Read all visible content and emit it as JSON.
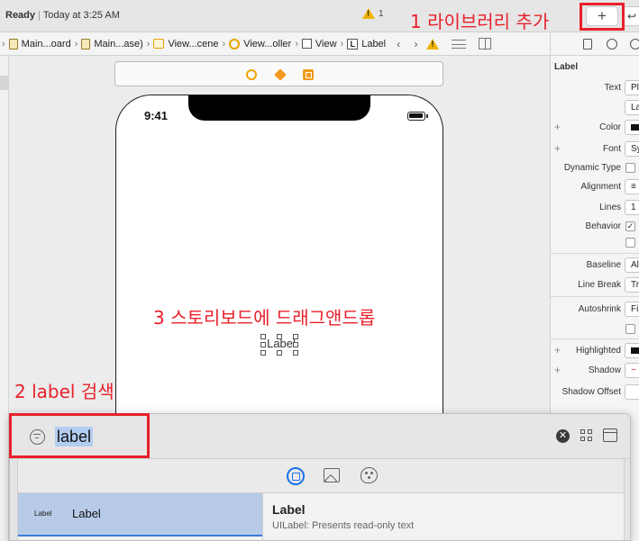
{
  "status": {
    "state": "Ready",
    "time": "Today at 3:25 AM",
    "warning_count": "1",
    "back_glyph": "↩"
  },
  "toolbar": {
    "library_glyph": "+"
  },
  "annotations": {
    "step1": "1 라이브러리 추가",
    "step2": "2 label 검색",
    "step3": "3 스토리보드에 드래그앤드롭",
    "color": "#e8212b"
  },
  "jump_bar": {
    "items": [
      {
        "label": "Main...oard",
        "icon": "storyboard-icon"
      },
      {
        "label": "Main...ase)",
        "icon": "storyboard-icon"
      },
      {
        "label": "View...cene",
        "icon": "scene-icon"
      },
      {
        "label": "View...oller",
        "icon": "view-controller-icon"
      },
      {
        "label": "View",
        "icon": "view-icon"
      },
      {
        "label": "Label",
        "icon": "label-icon"
      }
    ],
    "label_icon_glyph": "L",
    "nav_glyphs": "‹ ›"
  },
  "device": {
    "time": "9:41"
  },
  "canvas": {
    "dragged_label": "Label"
  },
  "inspector": {
    "title": "Label",
    "rows": {
      "text": {
        "label": "Text",
        "value": "Plain"
      },
      "text_value": {
        "value": "Label"
      },
      "color": {
        "label": "Color",
        "value": ""
      },
      "font": {
        "label": "Font",
        "value": "System"
      },
      "dynamic_type": {
        "label": "Dynamic Type"
      },
      "alignment": {
        "label": "Alignment",
        "value": "≡"
      },
      "lines": {
        "label": "Lines",
        "value": "1"
      },
      "behavior": {
        "label": "Behavior",
        "check": "✓"
      },
      "baseline": {
        "label": "Baseline",
        "value": "Align"
      },
      "line_break": {
        "label": "Line Break",
        "value": "Truncate"
      },
      "autoshrink": {
        "label": "Autoshrink",
        "value": "Fixed"
      },
      "highlighted": {
        "label": "Highlighted",
        "value": ""
      },
      "shadow": {
        "label": "Shadow",
        "value": "~"
      },
      "shadow_offset": {
        "label": "Shadow Offset",
        "value": ""
      }
    },
    "plus_glyph": "+"
  },
  "library": {
    "search_value": "label",
    "clear_glyph": "✕",
    "items": [
      {
        "thumb": "Label",
        "name": "Label"
      }
    ],
    "detail": {
      "title": "Label",
      "description": "UILabel: Presents read-only text"
    },
    "tabs": [
      "objects-tab",
      "media-tab",
      "colors-tab"
    ]
  }
}
